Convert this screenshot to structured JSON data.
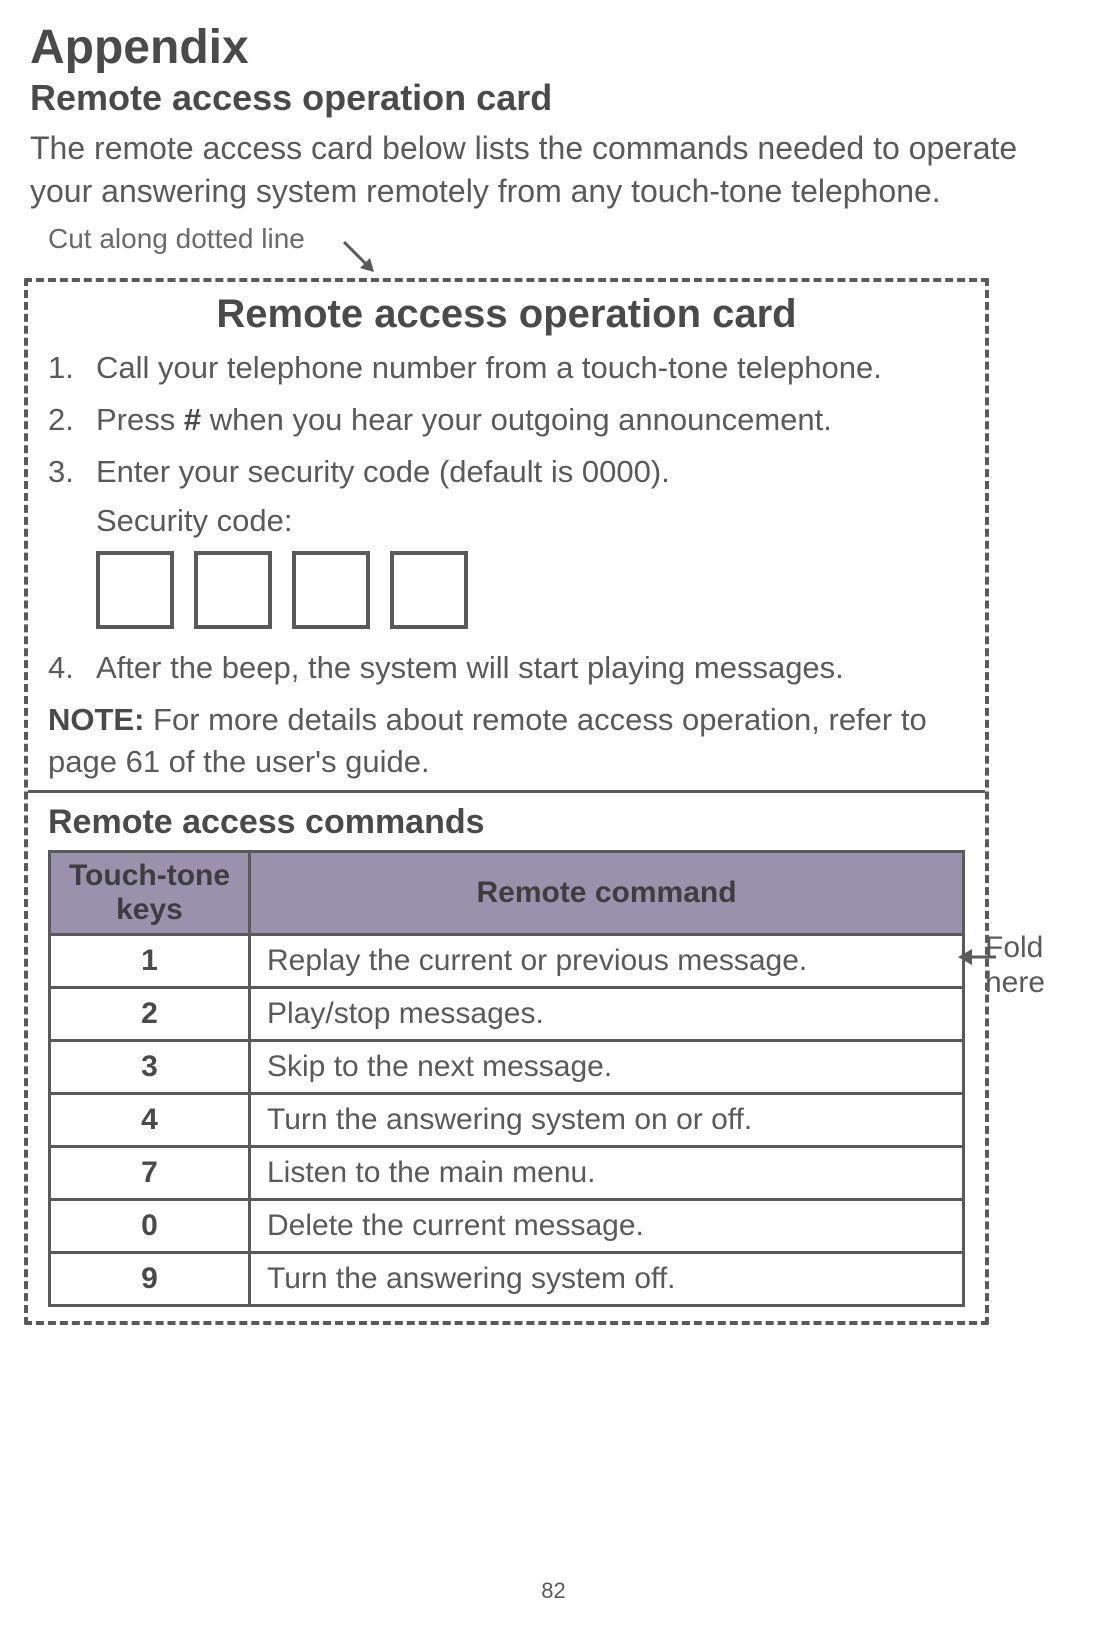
{
  "page": {
    "title": "Appendix",
    "subtitle": "Remote access operation card",
    "intro": "The remote access card below lists the commands needed to operate your answering system remotely from any touch-tone telephone.",
    "cut_label": "Cut along dotted line",
    "number": "82"
  },
  "card": {
    "title": "Remote access operation card",
    "step1": "Call your telephone number from a touch-tone telephone.",
    "step2_pre": "Press ",
    "step2_hash": "#",
    "step2_post": " when you hear your outgoing announcement.",
    "step3": "Enter your security code (default is 0000).",
    "security_label": "Security code:",
    "step4": "After the beep, the system will start playing messages.",
    "note_label": "NOTE:",
    "note_text": " For more details about remote access operation, refer to page 61 of the user's guide.",
    "commands_title": "Remote access commands",
    "fold_label_1": "Fold",
    "fold_label_2": "here"
  },
  "table": {
    "header_keys": "Touch-tone keys",
    "header_cmd": "Remote command",
    "rows": [
      {
        "key": "1",
        "cmd": "Replay the current or previous message."
      },
      {
        "key": "2",
        "cmd": "Play/stop messages."
      },
      {
        "key": "3",
        "cmd": "Skip to the next message."
      },
      {
        "key": "4",
        "cmd": "Turn the answering system on or off."
      },
      {
        "key": "7",
        "cmd": "Listen to the main menu."
      },
      {
        "key": "0",
        "cmd": "Delete the current message."
      },
      {
        "key": "9",
        "cmd": "Turn the answering system off."
      }
    ]
  }
}
